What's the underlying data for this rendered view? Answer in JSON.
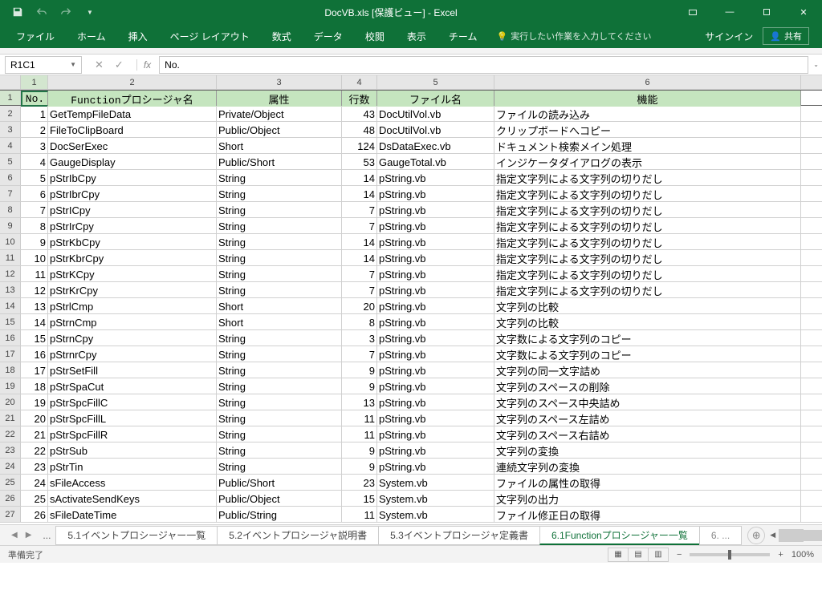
{
  "title": "DocVB.xls [保護ビュー] - Excel",
  "ribbon": [
    "ファイル",
    "ホーム",
    "挿入",
    "ページ レイアウト",
    "数式",
    "データ",
    "校閲",
    "表示",
    "チーム"
  ],
  "tellme": "実行したい作業を入力してください",
  "signin": "サインイン",
  "share": "共有",
  "namebox": "R1C1",
  "fx": "fx",
  "formula": "No.",
  "cols": [
    "1",
    "2",
    "3",
    "4",
    "5",
    "6"
  ],
  "headers": [
    "No.",
    "Functionプロシージャ名",
    "属性",
    "行数",
    "ファイル名",
    "機能"
  ],
  "rows": [
    [
      "1",
      "GetTempFileData",
      "Private/Object",
      "43",
      "DocUtilVol.vb",
      "ファイルの読み込み"
    ],
    [
      "2",
      "FileToClipBoard",
      "Public/Object",
      "48",
      "DocUtilVol.vb",
      "クリップボードへコピー"
    ],
    [
      "3",
      "DocSerExec",
      "Short",
      "124",
      "DsDataExec.vb",
      "ドキュメント検索メイン処理"
    ],
    [
      "4",
      "GaugeDisplay",
      "Public/Short",
      "53",
      "GaugeTotal.vb",
      "インジケータダイアログの表示"
    ],
    [
      "5",
      "pStrIbCpy",
      "String",
      "14",
      "pString.vb",
      "指定文字列による文字列の切りだし"
    ],
    [
      "6",
      "pStrIbrCpy",
      "String",
      "14",
      "pString.vb",
      "指定文字列による文字列の切りだし"
    ],
    [
      "7",
      "pStrICpy",
      "String",
      "7",
      "pString.vb",
      "指定文字列による文字列の切りだし"
    ],
    [
      "8",
      "pStrIrCpy",
      "String",
      "7",
      "pString.vb",
      "指定文字列による文字列の切りだし"
    ],
    [
      "9",
      "pStrKbCpy",
      "String",
      "14",
      "pString.vb",
      "指定文字列による文字列の切りだし"
    ],
    [
      "10",
      "pStrKbrCpy",
      "String",
      "14",
      "pString.vb",
      "指定文字列による文字列の切りだし"
    ],
    [
      "11",
      "pStrKCpy",
      "String",
      "7",
      "pString.vb",
      "指定文字列による文字列の切りだし"
    ],
    [
      "12",
      "pStrKrCpy",
      "String",
      "7",
      "pString.vb",
      "指定文字列による文字列の切りだし"
    ],
    [
      "13",
      "pStrlCmp",
      "Short",
      "20",
      "pString.vb",
      "文字列の比較"
    ],
    [
      "14",
      "pStrnCmp",
      "Short",
      "8",
      "pString.vb",
      "文字列の比較"
    ],
    [
      "15",
      "pStrnCpy",
      "String",
      "3",
      "pString.vb",
      "文字数による文字列のコピー"
    ],
    [
      "16",
      "pStrnrCpy",
      "String",
      "7",
      "pString.vb",
      "文字数による文字列のコピー"
    ],
    [
      "17",
      "pStrSetFill",
      "String",
      "9",
      "pString.vb",
      "文字列の同一文字詰め"
    ],
    [
      "18",
      "pStrSpaCut",
      "String",
      "9",
      "pString.vb",
      "文字列のスペースの削除"
    ],
    [
      "19",
      "pStrSpcFillC",
      "String",
      "13",
      "pString.vb",
      "文字列のスペース中央詰め"
    ],
    [
      "20",
      "pStrSpcFillL",
      "String",
      "11",
      "pString.vb",
      "文字列のスペース左詰め"
    ],
    [
      "21",
      "pStrSpcFillR",
      "String",
      "11",
      "pString.vb",
      "文字列のスペース右詰め"
    ],
    [
      "22",
      "pStrSub",
      "String",
      "9",
      "pString.vb",
      "文字列の変換"
    ],
    [
      "23",
      "pStrTin",
      "String",
      "9",
      "pString.vb",
      "連続文字列の変換"
    ],
    [
      "24",
      "sFileAccess",
      "Public/Short",
      "23",
      "System.vb",
      "ファイルの属性の取得"
    ],
    [
      "25",
      "sActivateSendKeys",
      "Public/Object",
      "15",
      "System.vb",
      "文字列の出力"
    ],
    [
      "26",
      "sFileDateTime",
      "Public/String",
      "11",
      "System.vb",
      "ファイル修正日の取得"
    ]
  ],
  "sheets": {
    "list": [
      "5.1イベントプロシージャー一覧",
      "5.2イベントプロシージャ説明書",
      "5.3イベントプロシージャ定義書",
      "6.1Functionプロシージャー一覧"
    ],
    "active": 3,
    "trunc": "6.",
    "dots": "..."
  },
  "status": "準備完了",
  "zoom": "100%",
  "zoom_minus": "−",
  "zoom_plus": "+"
}
